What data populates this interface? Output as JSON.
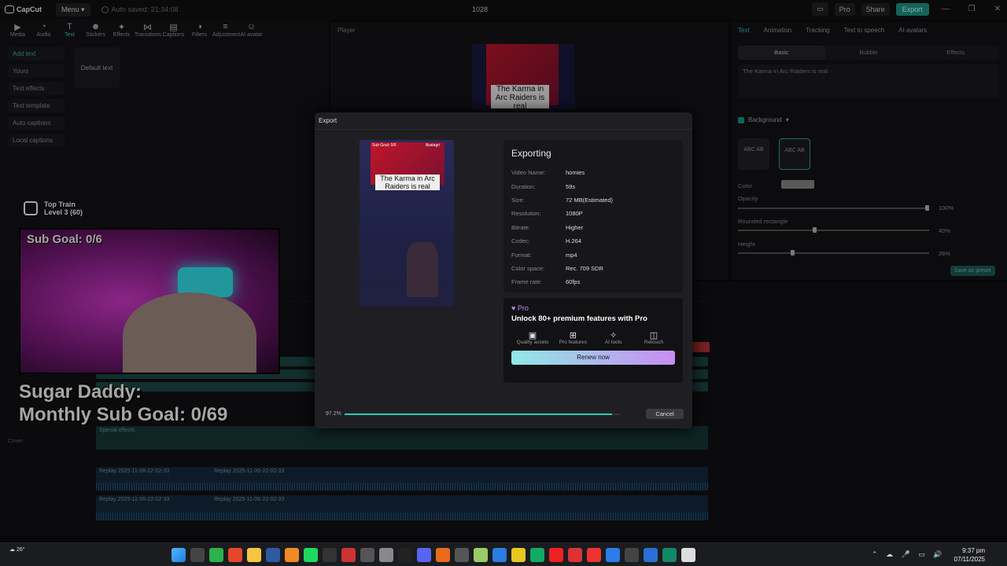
{
  "titlebar": {
    "app_name": "CapCut",
    "menu_label": "Menu",
    "autosave": "Auto saved: 21:34:08",
    "project_title": "1028",
    "pro_label": "Pro",
    "share_label": "Share",
    "export_label": "Export"
  },
  "toolbar": {
    "items": [
      "Media",
      "Audio",
      "Text",
      "Stickers",
      "Effects",
      "Transitions",
      "Captions",
      "Filters",
      "Adjustment",
      "AI avatar"
    ],
    "icons": [
      "media-icon",
      "audio-icon",
      "text-icon",
      "stickers-icon",
      "effects-icon",
      "transitions-icon",
      "captions-icon",
      "filters-icon",
      "adjustment-icon",
      "ai-avatar-icon"
    ]
  },
  "text_panel": {
    "categories": [
      "Add text",
      "Yours",
      "Text effects",
      "Text template",
      "Auto captions",
      "Local captions"
    ],
    "default_card": "Default text"
  },
  "player": {
    "label": "Player",
    "thumb_caption": "The Karma in Arc Raiders is real"
  },
  "right_panel": {
    "tabs": [
      "Text",
      "Animation",
      "Tracking",
      "Text to speech",
      "AI avatars"
    ],
    "subtabs": [
      "Basic",
      "Bubble",
      "Effects"
    ],
    "text_value": "The Karma in Arc Raiders is real",
    "background_label": "Background",
    "swatch_label": "ABC AB",
    "color_label": "Color",
    "opacity_label": "Opacity",
    "opacity_value": "100%",
    "opacity_level": 1.0,
    "rounded_label": "Rounded rectangle",
    "rounded_value": "40%",
    "rounded_level": 0.4,
    "height_label": "Height",
    "height_value": "28%",
    "height_level": 0.28,
    "save_preset": "Save as preset"
  },
  "overlay": {
    "train_title": "Top Train",
    "train_level": "Level 3 (60)",
    "sub_goal": "Sub Goal: 0/6",
    "sugar_line1": "Sugar Daddy:",
    "sugar_line2": "Monthly Sub Goal: 0/69"
  },
  "timeline": {
    "clip1": "Replay 2025-11-06-22-02-33",
    "clip2": "Replay 2025-11-06-22-02-33",
    "effects_clip": "Special effects",
    "cover_label": "Cover"
  },
  "export_dialog": {
    "title": "Export",
    "heading": "Exporting",
    "preview_caption": "The Karma in Arc Raiders is real",
    "preview_left": "Sub Goal: 0/6",
    "preview_right": "illustagri",
    "info": [
      {
        "k": "Video Name:",
        "v": "homies"
      },
      {
        "k": "Duration:",
        "v": "59s"
      },
      {
        "k": "Size:",
        "v": "72 MB(Estimated)"
      },
      {
        "k": "Resolution:",
        "v": "1080P"
      },
      {
        "k": "Bitrate:",
        "v": "Higher"
      },
      {
        "k": "Codec:",
        "v": "H.264"
      },
      {
        "k": "Format:",
        "v": "mp4"
      },
      {
        "k": "Color space:",
        "v": "Rec. 709 SDR"
      },
      {
        "k": "Frame rate:",
        "v": "60fps"
      }
    ],
    "pro_tag": "Pro",
    "pro_title": "Unlock 80+ premium features with Pro",
    "features": [
      "Quality assets",
      "Pro features",
      "AI tools",
      "Retouch"
    ],
    "renew_label": "Renew now",
    "progress_text": "97.2%",
    "progress_value": 0.972,
    "cancel_label": "Cancel"
  },
  "taskbar": {
    "temperature": "26°",
    "time": "9:37 pm",
    "date": "07/11/2025"
  }
}
